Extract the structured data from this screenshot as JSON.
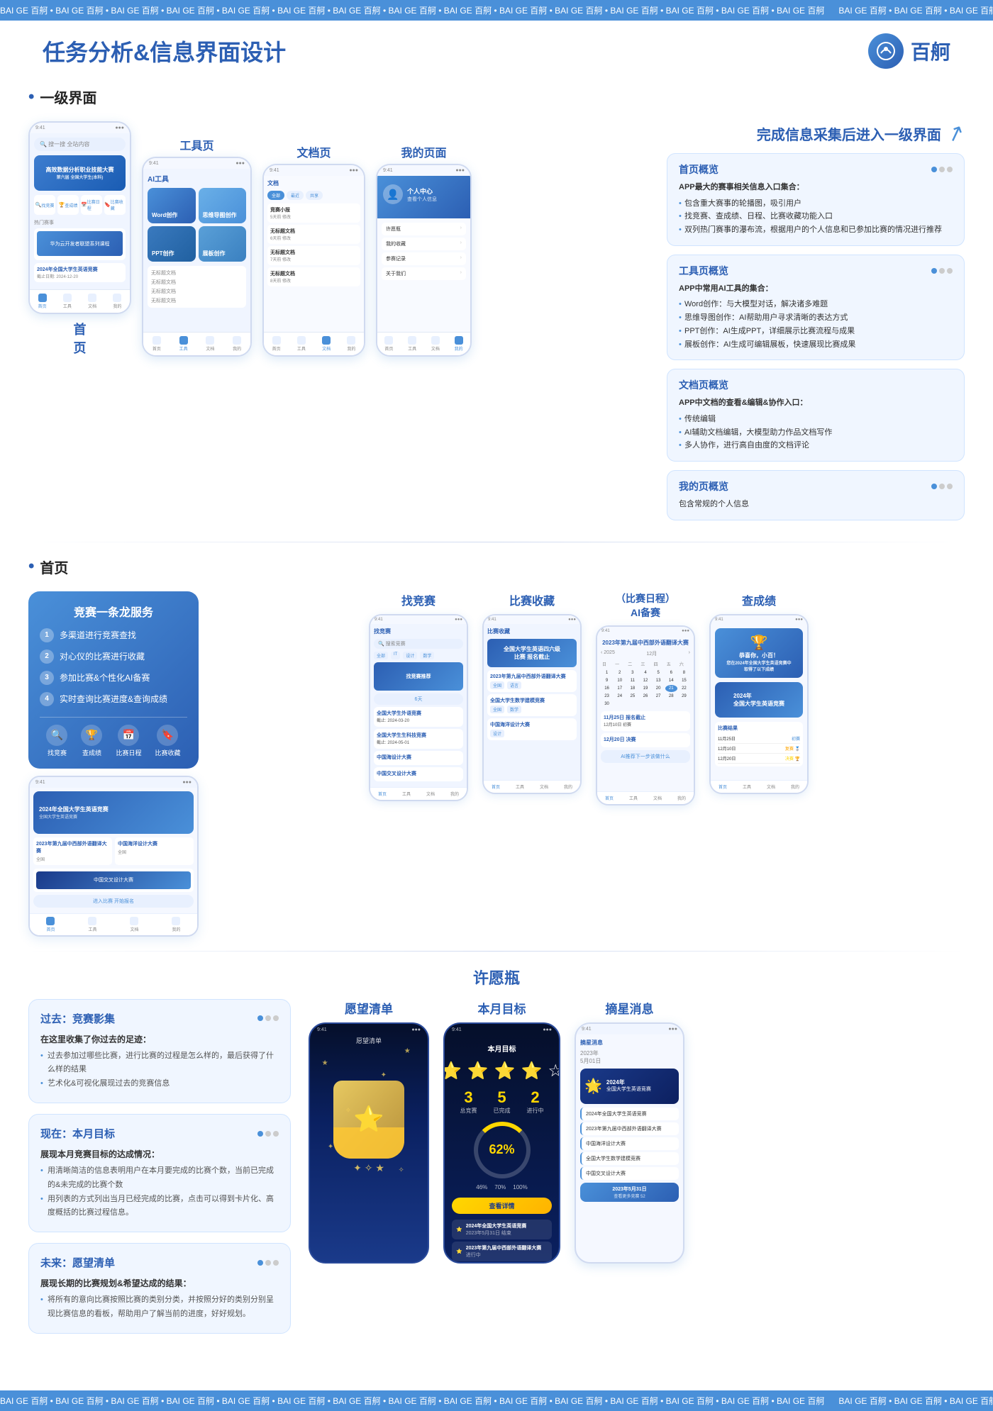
{
  "ticker": {
    "items": [
      "BAI GE 百舸",
      "BAI GE 百舸",
      "BAI GE 百舸",
      "BAI GE 百舸",
      "BAI GE 百舸",
      "BAI GE 百舸",
      "BAI GE 百舸",
      "BAI GE 百舸",
      "BAI GE 百舸",
      "BAI GE 百舸",
      "BAI GE 百舸",
      "BAI GE 百舸"
    ]
  },
  "header": {
    "title": "任务分析&信息界面设计",
    "logo_text": "百舸"
  },
  "section1": {
    "title": "一级界面",
    "right_title": "完成信息采集后进入一级界面",
    "panels": [
      {
        "title": "首页概览",
        "desc": "APP最大的赛事相关信息入口集合：",
        "items": [
          "包含重大赛事的轮播图，吸引用户",
          "找竞赛、查成绩、日程、比赛收藏功能入口",
          "双列热门赛事的瀑布流，根据用户的个人信息和已参加比赛的情况进行推荐"
        ]
      },
      {
        "title": "工具页概览",
        "desc": "APP中常用AI工具的集合：",
        "items": [
          "Word创作：与大模型对话，解决诸多难题",
          "思维导图创作：AI帮助用户寻求清晰的表达方式",
          "PPT创作：AI生成PPT，详细展示比赛流程与成果",
          "展板创作：AI生成可编辑展板，快速展现比赛成果"
        ]
      },
      {
        "title": "文档页概览",
        "desc": "APP中文档的查看&编辑&协作入口：",
        "items": [
          "传统编辑",
          "AI辅助文档编辑，大模型助力作品文档写作",
          "多人协作，进行高自由度的文档评论"
        ]
      },
      {
        "title": "我的页概览",
        "desc": "包含常规的个人信息",
        "items": []
      }
    ],
    "phone_labels": {
      "home": "首\n页",
      "tool": "工具页",
      "doc": "文档页",
      "my": "我的页面"
    },
    "ai_tool_label": "AI工具",
    "doc_label": "思维导图创作"
  },
  "section2": {
    "title": "首页",
    "service": {
      "title": "竞赛一条龙服务",
      "items": [
        "多渠道进行竞赛查找",
        "对心仪的比赛进行收藏",
        "参加比赛&个性化AI备赛",
        "实时查询比赛进度&查询成绩"
      ],
      "icons": [
        "找竞赛",
        "查成绩",
        "比赛日程",
        "比赛收藏"
      ]
    },
    "phone_labels": [
      "找竞赛",
      "比赛收藏",
      "（比赛日程）\nAI备赛",
      "查成绩"
    ]
  },
  "section3": {
    "title": "许愿瓶",
    "subtitle_wish": "愿望清单",
    "subtitle_goal": "本月目标",
    "subtitle_star": "摘星消息",
    "panels": [
      {
        "time": "过去：竞赛影集",
        "desc": "在这里收集了你过去的足迹：",
        "items": [
          "过去参加过哪些比赛，进行比赛的过程是怎么样的，最后获得了什么样的结果",
          "艺术化&可视化展现过去的竞赛信息"
        ]
      },
      {
        "time": "现在：本月目标",
        "desc": "展现本月竞赛目标的达成情况：",
        "items": [
          "用清晰简洁的信息表明用户在本月要完成的比赛个数，当前已完成的&未完成的比赛个数",
          "用列表的方式列出当月已经完成的比赛，点击可以得到卡片化、高度概括的比赛过程信息。"
        ]
      },
      {
        "time": "未来：愿望清单",
        "desc": "展现长期的比赛规划&希望达成的结果：",
        "items": [
          "将所有的意向比赛按照比赛的类别分类，并按照分好的类别分别呈现比赛信息的看板，帮助用户了解当前的进度，好好规划。"
        ]
      }
    ]
  },
  "icons": {
    "search": "🔍",
    "home": "🏠",
    "trophy": "🏆",
    "calendar": "📅",
    "bookmark": "🔖",
    "star": "⭐",
    "user": "👤",
    "doc": "📄",
    "tool": "🔧",
    "bottle": "🍯",
    "sparkle": "✨",
    "arrow": "↗"
  }
}
